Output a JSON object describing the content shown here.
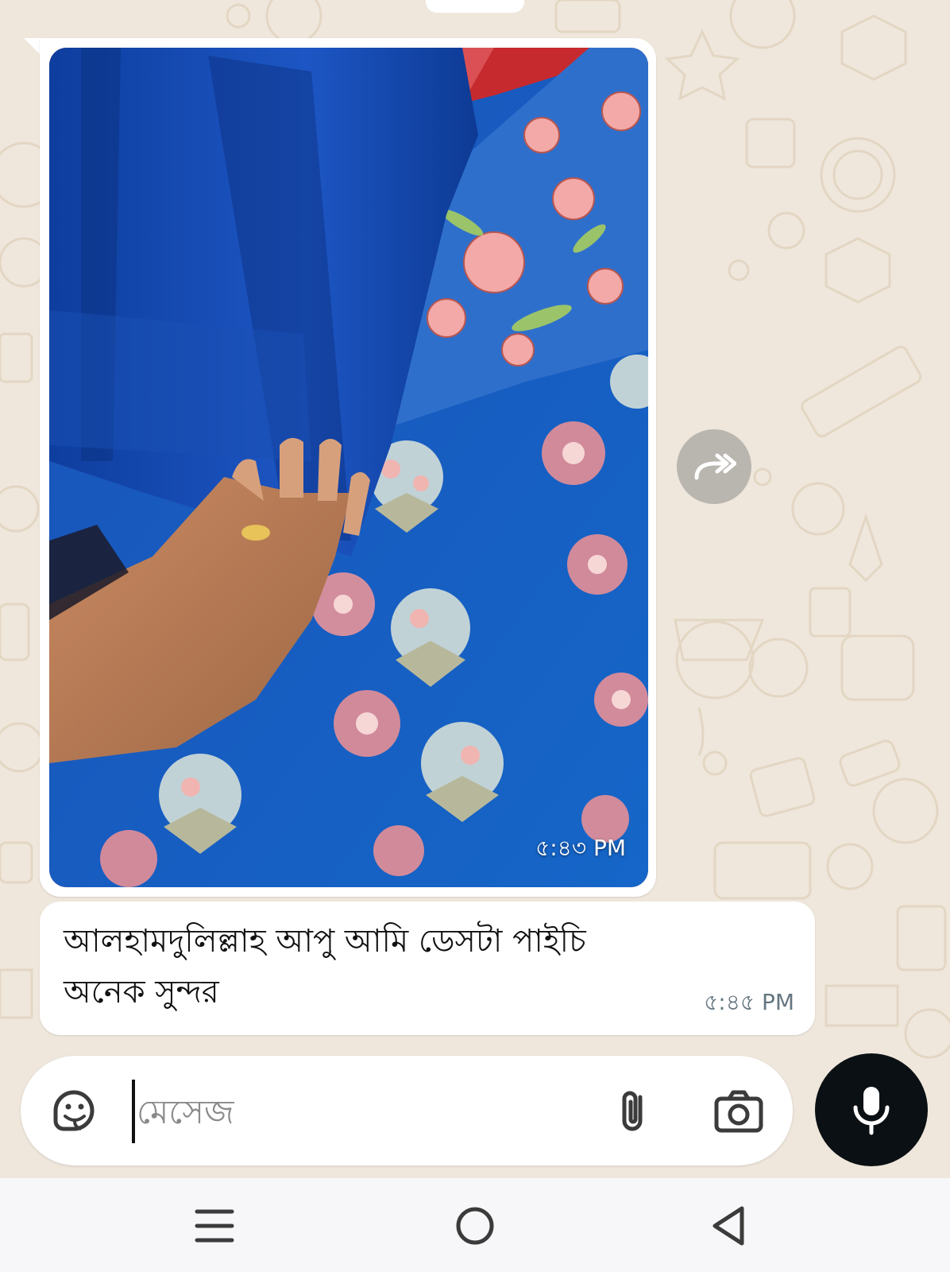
{
  "chat": {
    "image_message": {
      "time": "৫:৪৩ PM",
      "image_description_icon": "photo-of-blue-floral-fabric"
    },
    "text_message": {
      "line1": "আলহামদুলিল্লাহ  আপু আমি   ডেসটা পাইচি",
      "line2": "অনেক সুন্দর",
      "time": "৫:৪৫ PM"
    },
    "forward_icon": "forward-icon"
  },
  "composer": {
    "placeholder": "মেসেজ",
    "value": "",
    "icons": [
      "sticker-icon",
      "attach-icon",
      "camera-icon",
      "mic-icon"
    ]
  },
  "navbar": {
    "icons": [
      "recents-icon",
      "home-icon",
      "back-icon"
    ]
  },
  "colors": {
    "wallpaper": "#efe7dc",
    "bubble": "#ffffff",
    "mic_button": "#0b1014",
    "timestamp": "#667781"
  }
}
